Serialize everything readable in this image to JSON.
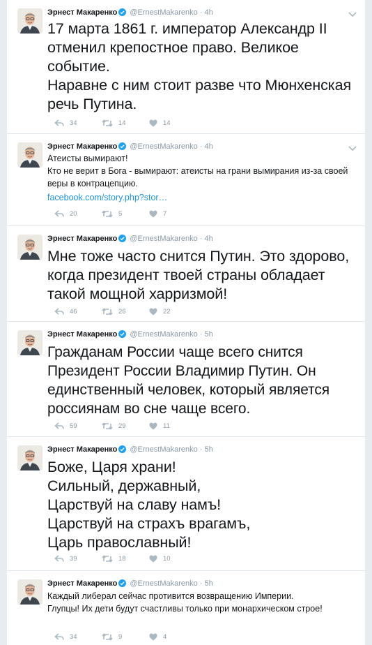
{
  "colors": {
    "verified": "#1da1f2",
    "icon_gray": "#aab8c2",
    "link": "#1b95e0"
  },
  "icons": {
    "reply": "reply-icon",
    "retweet": "retweet-icon",
    "like": "heart-icon",
    "menu": "chevron-down-icon"
  },
  "tweets": [
    {
      "name": "Эрнест Макаренко",
      "handle": "@ErnestMakarenko",
      "time": "· 4h",
      "text": "17 марта 1861 г. император Александр II отменил крепостное право. Великое событие.\nНаравне с ним стоит разве что Мюнхенская речь Путина.",
      "link": "",
      "replies": "34",
      "retweets": "14",
      "likes": "14"
    },
    {
      "name": "Эрнест Макаренко",
      "handle": "@ErnestMakarenko",
      "time": "· 4h",
      "text": "Атеисты вымирают!\nКто не верит в Бога - вымирают: атеисты на грани вымирания из-за своей веры в контрацепцию.",
      "link": "facebook.com/story.php?stor…",
      "replies": "20",
      "retweets": "5",
      "likes": "7"
    },
    {
      "name": "Эрнест Макаренко",
      "handle": "@ErnestMakarenko",
      "time": "· 4h",
      "text": "Мне тоже часто снится Путин. Это здорово, когда президент твоей страны обладает такой мощной харризмой!",
      "link": "",
      "replies": "46",
      "retweets": "26",
      "likes": "22"
    },
    {
      "name": "Эрнест Макаренко",
      "handle": "@ErnestMakarenko",
      "time": "· 5h",
      "text": "Гражданам России чаще всего снится Президент России Владимир Путин. Он единственный человек, который является россиянам во сне чаще всего.",
      "link": "",
      "replies": "59",
      "retweets": "29",
      "likes": "11"
    },
    {
      "name": "Эрнест Макаренко",
      "handle": "@ErnestMakarenko",
      "time": "· 5h",
      "text": "Боже, Царя храни!\nСильный, державный,\nЦарствуй на славу намъ!\nЦарствуй на страхъ врагамъ,\nЦарь православный!",
      "link": "",
      "replies": "39",
      "retweets": "18",
      "likes": "10"
    },
    {
      "name": "Эрнест Макаренко",
      "handle": "@ErnestMakarenko",
      "time": "· 5h",
      "text": "Каждый либерал сейчас противится возвращению Империи.\nГлупцы! Их дети будут счастливы только при монархическом строе!",
      "link": "",
      "replies": "34",
      "retweets": "9",
      "likes": "4"
    }
  ]
}
